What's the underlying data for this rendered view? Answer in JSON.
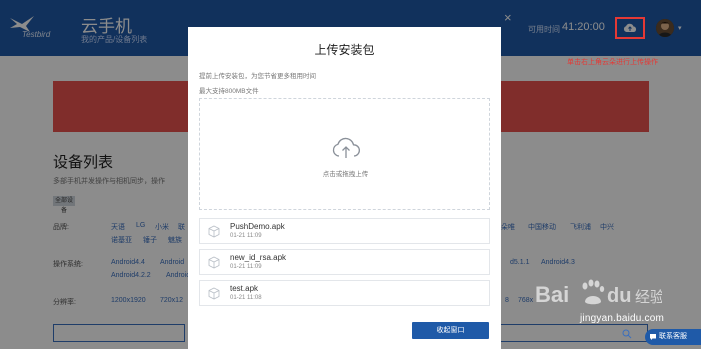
{
  "header": {
    "logo_text": "Testbird",
    "title": "云手机",
    "breadcrumb": [
      "我的产品",
      "/",
      "设备列表"
    ],
    "remaining_label": "可用时间",
    "remaining_time": "41:20:00",
    "close_glyph": "×",
    "avatar_caret": "▾"
  },
  "annotation": "单击右上角云朵进行上传操作",
  "background": {
    "section_title": "设备列表",
    "section_desc": "多部手机并发操作与相机同步",
    "section_desc_suffix": "，操作",
    "all_button": "全部设备",
    "rows": [
      {
        "label": "品牌:",
        "links_line1": [
          "天语",
          "LG",
          "小米",
          "联"
        ],
        "links_line1_right": [
          "朵唯",
          "中国移动",
          "飞利浦",
          "中兴"
        ],
        "links_line2": [
          "诺基亚",
          "锤子",
          "魅族"
        ]
      },
      {
        "label": "操作系统:",
        "links_line1": [
          "Android4.4",
          "Android"
        ],
        "links_line1_right": [
          "d5.1.1",
          "Android4.3"
        ],
        "links_line2": [
          "Android4.2.2",
          "Android"
        ]
      },
      {
        "label": "分辨率:",
        "links_line1": [
          "1200x1920",
          "720x12"
        ],
        "links_line1_right": [
          "8",
          "768x"
        ]
      }
    ]
  },
  "modal": {
    "title": "上传安装包",
    "hint1": "提前上传安装包，为您节省更多租用时间",
    "hint2": "最大支持800MB文件",
    "drop_text": "点击或拖拽上传",
    "files": [
      {
        "name": "PushDemo.apk",
        "time": "01-21 11:09"
      },
      {
        "name": "new_id_rsa.apk",
        "time": "01-21 11:09"
      },
      {
        "name": "test.apk",
        "time": "01-21 11:08"
      }
    ],
    "close_button": "收起窗口"
  },
  "watermark": {
    "text": "jingyan.baidu.com",
    "brand": "Baidu经验"
  },
  "chat_button": "联系客服",
  "colors": {
    "header_bg": "#1f5aa8",
    "accent": "#1f5aa8",
    "annotation": "#e53935",
    "banner": "#e9534f"
  }
}
